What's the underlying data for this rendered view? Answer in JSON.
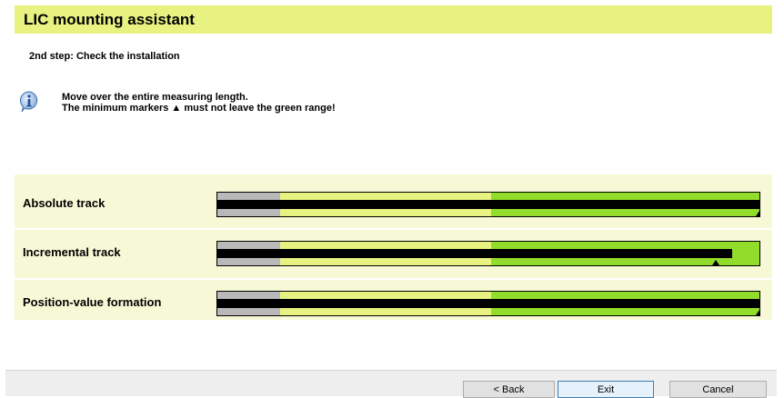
{
  "header": {
    "title": "LIC mounting assistant"
  },
  "step": {
    "text": "2nd step: Check the installation"
  },
  "info": {
    "icon": "info-icon",
    "line1": "Move over the entire measuring length.",
    "line2": "The minimum markers ▲ must not leave the green range!"
  },
  "colors": {
    "accent_yellow": "#e8f280",
    "range_gray": "#b9b9b9",
    "range_green": "#92dc2c",
    "panel": "#f7f9d6"
  },
  "tracks": [
    {
      "label": "Absolute track",
      "level": 1.0,
      "min_marker": 1.0
    },
    {
      "label": "Incremental track",
      "level": 0.95,
      "min_marker": 0.92
    },
    {
      "label": "Position-value formation",
      "level": 1.0,
      "min_marker": 1.0
    }
  ],
  "scale": {
    "gray_end": 0.115,
    "green_start": 0.505
  },
  "buttons": {
    "back": "< Back",
    "exit": "Exit",
    "cancel": "Cancel"
  }
}
